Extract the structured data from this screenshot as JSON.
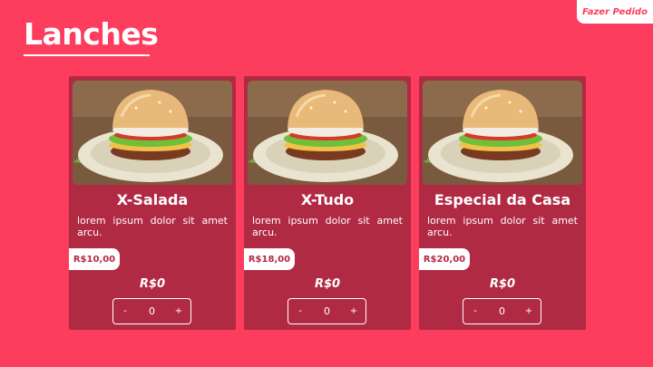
{
  "header": {
    "title": "Lanches",
    "order_button": "Fazer Pedido"
  },
  "colors": {
    "background": "#fd3d5d",
    "card": "#b12a44",
    "accent": "#ffffff"
  },
  "products": [
    {
      "name": "X-Salada",
      "description": "lorem ipsum dolor sit amet arcu.",
      "price": "R$10,00",
      "total": "R$0",
      "quantity": "0",
      "minus_label": "-",
      "plus_label": "+",
      "image_icon": "burger-photo"
    },
    {
      "name": "X-Tudo",
      "description": "lorem ipsum dolor sit amet arcu.",
      "price": "R$18,00",
      "total": "R$0",
      "quantity": "0",
      "minus_label": "-",
      "plus_label": "+",
      "image_icon": "burger-photo"
    },
    {
      "name": "Especial da Casa",
      "description": "lorem ipsum dolor sit amet arcu.",
      "price": "R$20,00",
      "total": "R$0",
      "quantity": "0",
      "minus_label": "-",
      "plus_label": "+",
      "image_icon": "burger-photo"
    }
  ]
}
